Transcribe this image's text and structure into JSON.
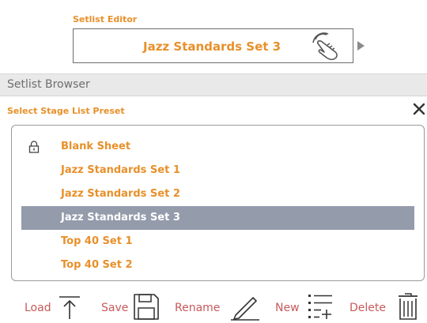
{
  "editor": {
    "label": "Setlist Editor",
    "current_setlist": "Jazz Standards Set 3",
    "touch_icon": "hand-touch-icon",
    "next_icon": "play-arrow-icon"
  },
  "browser": {
    "title": "Setlist Browser"
  },
  "preset_panel": {
    "label": "Select Stage List Preset",
    "close_icon": "close-icon",
    "items": [
      {
        "label": "Blank Sheet",
        "locked": true,
        "selected": false
      },
      {
        "label": "Jazz Standards Set 1",
        "locked": false,
        "selected": false
      },
      {
        "label": "Jazz Standards Set 2",
        "locked": false,
        "selected": false
      },
      {
        "label": "Jazz Standards Set 3",
        "locked": false,
        "selected": true
      },
      {
        "label": "Top 40 Set 1",
        "locked": false,
        "selected": false
      },
      {
        "label": "Top 40 Set 2",
        "locked": false,
        "selected": false
      }
    ]
  },
  "toolbar": {
    "load_label": "Load",
    "save_label": "Save",
    "rename_label": "Rename",
    "new_label": "New",
    "delete_label": "Delete"
  },
  "colors": {
    "accent": "#e8902a",
    "selected_row": "#949bab",
    "toolbar_text": "#c85a5a"
  }
}
